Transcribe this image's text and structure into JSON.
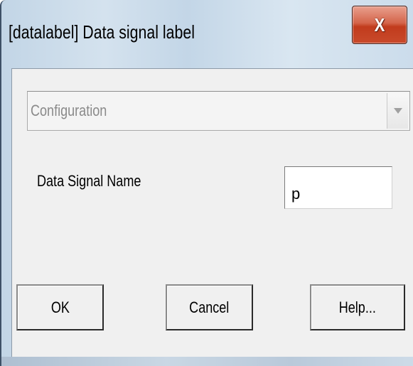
{
  "window": {
    "title": "[datalabel] Data signal label",
    "close_label": "X"
  },
  "configuration": {
    "selected": "Configuration"
  },
  "signal": {
    "label": "Data Signal Name",
    "value": "p"
  },
  "buttons": {
    "ok": "OK",
    "cancel": "Cancel",
    "help": "Help..."
  },
  "colors": {
    "title_bar": "#c9dbeb",
    "close_button": "#c94a2b",
    "client_bg": "#f0f0f0"
  }
}
